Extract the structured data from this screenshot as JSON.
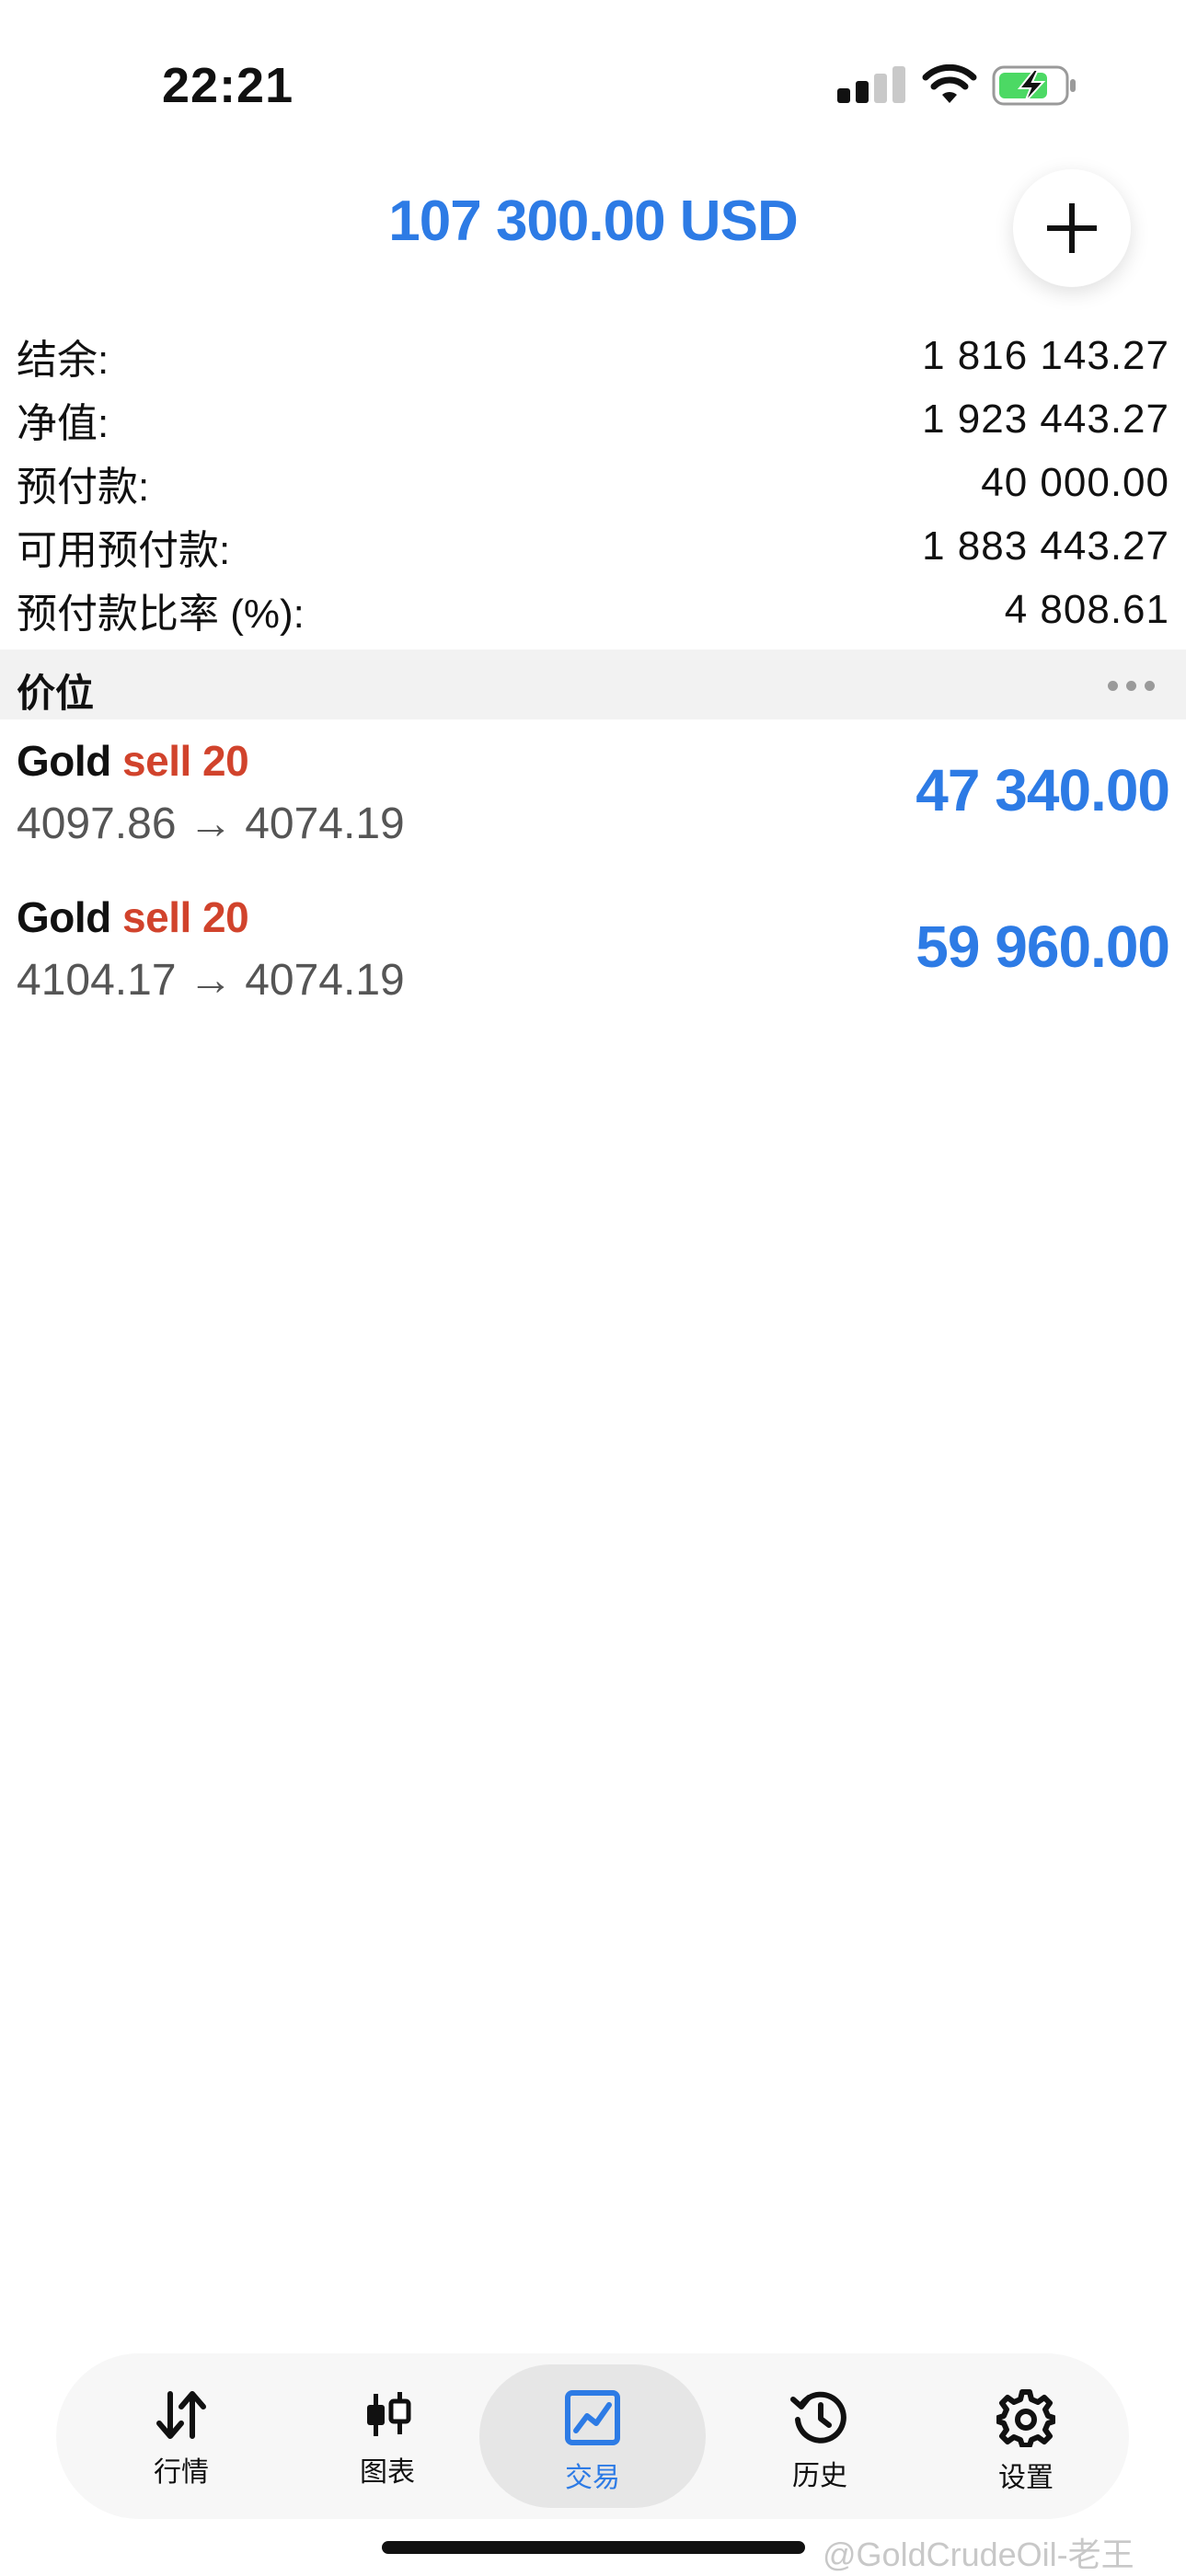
{
  "status_bar": {
    "time": "22:21",
    "battery_charging": true
  },
  "header": {
    "balance": "107 300.00 USD",
    "add_button": "+"
  },
  "summary": [
    {
      "label": "结余:",
      "value": "1 816 143.27"
    },
    {
      "label": "净值:",
      "value": "1 923 443.27"
    },
    {
      "label": "预付款:",
      "value": "40 000.00"
    },
    {
      "label": "可用预付款:",
      "value": "1 883 443.27"
    },
    {
      "label": "预付款比率 (%):",
      "value": "4 808.61"
    }
  ],
  "positions_section": {
    "title": "价位"
  },
  "positions": [
    {
      "symbol": "Gold",
      "side": "sell 20",
      "open": "4097.86",
      "arrow": "→",
      "current": "4074.19",
      "profit": "47 340.00"
    },
    {
      "symbol": "Gold",
      "side": "sell 20",
      "open": "4104.17",
      "arrow": "→",
      "current": "4074.19",
      "profit": "59 960.00"
    }
  ],
  "tabbar": {
    "tabs": [
      {
        "label": "行情",
        "icon": "quotes-icon",
        "active": false
      },
      {
        "label": "图表",
        "icon": "chart-icon",
        "active": false
      },
      {
        "label": "交易",
        "icon": "trade-icon",
        "active": true
      },
      {
        "label": "历史",
        "icon": "history-icon",
        "active": false
      },
      {
        "label": "设置",
        "icon": "settings-icon",
        "active": false
      }
    ]
  },
  "watermark": "@GoldCrudeOil-老王",
  "colors": {
    "accent": "#2d7be5",
    "sell": "#d1432c",
    "battery": "#4cd964"
  }
}
